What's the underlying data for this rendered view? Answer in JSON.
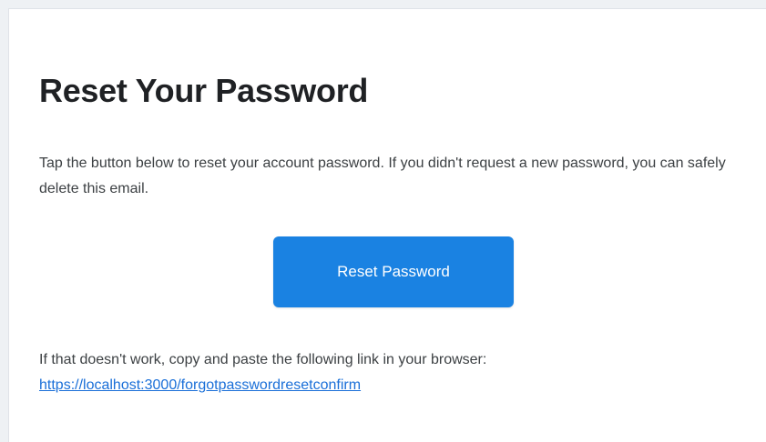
{
  "email": {
    "headline": "Reset Your Password",
    "intro": "Tap the button below to reset your account password. If you didn't request a new password, you can safely delete this email.",
    "button_label": "Reset Password",
    "fallback_text": "If that doesn't work, copy and paste the following link in your browser:",
    "fallback_link": "https://localhost:3000/forgotpasswordresetconfirm"
  },
  "colors": {
    "accent": "#1a82e2",
    "link": "#1a6fd8",
    "heading": "#1f2124",
    "body_text": "#3c4043",
    "page_background": "#eef1f4",
    "card_background": "#ffffff"
  }
}
